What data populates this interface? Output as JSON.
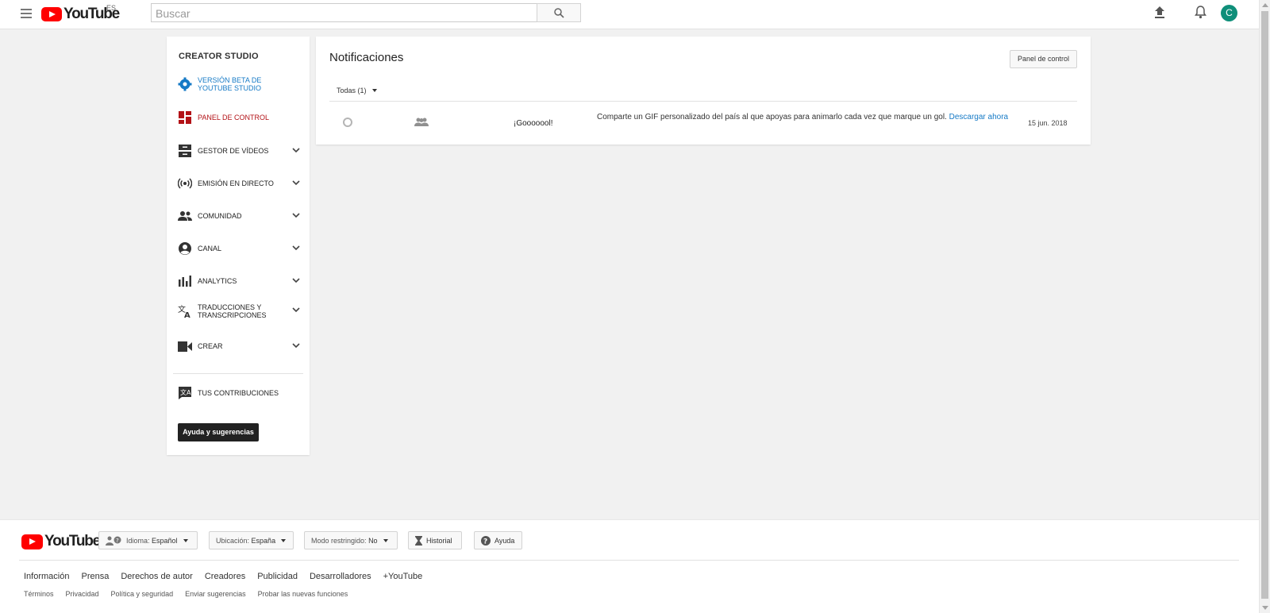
{
  "header": {
    "logo_text": "YouTube",
    "region": "ES",
    "search_placeholder": "Buscar",
    "avatar_letter": "C"
  },
  "sidebar": {
    "title": "CREATOR STUDIO",
    "items": [
      {
        "label": "VERSIÓN BETA DE YOUTUBE STUDIO",
        "icon": "gear-icon"
      },
      {
        "label": "PANEL DE CONTROL",
        "icon": "dashboard-icon"
      },
      {
        "label": "GESTOR DE VÍDEOS",
        "icon": "video-manager-icon"
      },
      {
        "label": "EMISIÓN EN DIRECTO",
        "icon": "live-icon"
      },
      {
        "label": "COMUNIDAD",
        "icon": "community-icon"
      },
      {
        "label": "CANAL",
        "icon": "channel-icon"
      },
      {
        "label": "ANALYTICS",
        "icon": "analytics-icon"
      },
      {
        "label": "TRADUCCIONES Y TRANSCRIPCIONES",
        "icon": "translate-icon"
      },
      {
        "label": "CREAR",
        "icon": "camera-icon"
      },
      {
        "label": "TUS CONTRIBUCIONES",
        "icon": "contributions-icon"
      }
    ],
    "help_button": "Ayuda y sugerencias"
  },
  "main": {
    "title": "Notificaciones",
    "panel_button": "Panel de control",
    "filter": "Todas (1)",
    "notification": {
      "title": "¡Gooooool!",
      "text": "Comparte un GIF personalizado del país al que apoyas para animarlo cada vez que marque un gol.",
      "link": "Descargar ahora",
      "date": "15 jun. 2018"
    }
  },
  "footer": {
    "logo_text": "YouTube",
    "language_label": "Idioma:",
    "language_value": "Español",
    "location_label": "Ubicación:",
    "location_value": "España",
    "restricted_label": "Modo restringido:",
    "restricted_value": "No",
    "history": "Historial",
    "help": "Ayuda",
    "links": [
      "Información",
      "Prensa",
      "Derechos de autor",
      "Creadores",
      "Publicidad",
      "Desarrolladores",
      "+YouTube"
    ],
    "sublinks": [
      "Términos",
      "Privacidad",
      "Política y seguridad",
      "Enviar sugerencias",
      "Probar las nuevas funciones"
    ]
  },
  "colors": {
    "accent_blue": "#167ac6",
    "accent_red": "#b31217",
    "brand_red": "#ff0000",
    "avatar": "#0f8f7a"
  }
}
